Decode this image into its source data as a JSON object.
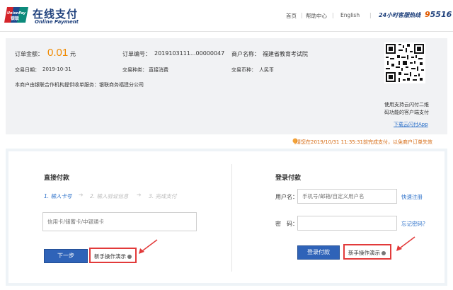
{
  "brand": {
    "logo_text": "UnionPay 银联",
    "title_cn": "在线支付",
    "title_en": "Online Payment"
  },
  "topnav": {
    "items": [
      "首页",
      "帮助中心",
      "English"
    ],
    "hotline_label": "24小时客服热线",
    "hotline_prefix": "9",
    "hotline_rest": "5516"
  },
  "order": {
    "amount_label": "订单金额：",
    "amount_value": "0.01",
    "amount_unit": "元",
    "order_no_label": "订单编号：",
    "order_no_value": "2019103111...00000047",
    "merchant_label": "商户名称：",
    "merchant_value": "福建省教育考试院",
    "date_label": "交易日期：",
    "date_value": "2019-10-31",
    "type_label": "交易种类：",
    "type_value": "直接消费",
    "currency_label": "交易币种：",
    "currency_value": "人民币",
    "service_note": "本商户由银联合作机构提供收单服务：银联商务福建分公司",
    "qr_caption_1": "使用支持云闪付二维",
    "qr_caption_2": "码功能的客户端支付",
    "qr_download": "下载云闪付App"
  },
  "notice": "请您在2019/10/31 11:35:31前完成支付，以免商户订单失效",
  "direct_pay": {
    "title": "直接付款",
    "steps": [
      "1. 输入卡号",
      "2. 输入验证信息",
      "3. 完成支付"
    ],
    "card_placeholder": "信用卡/储蓄卡/中银通卡",
    "next_button": "下一步",
    "demo_link": "新手操作演示"
  },
  "login_pay": {
    "title": "登录付款",
    "username_label": "用户名：",
    "username_placeholder": "手机号/邮箱/自定义用户名",
    "register_link": "快速注册",
    "password_label": "密　码：",
    "forgot_link": "忘记密码？",
    "login_button": "登录付款",
    "demo_link": "新手操作演示"
  },
  "colors": {
    "brand_blue": "#1d3f7b",
    "amount_orange": "#f08a00",
    "link_blue": "#2a6fc9",
    "highlight_red": "#e23a3a"
  }
}
